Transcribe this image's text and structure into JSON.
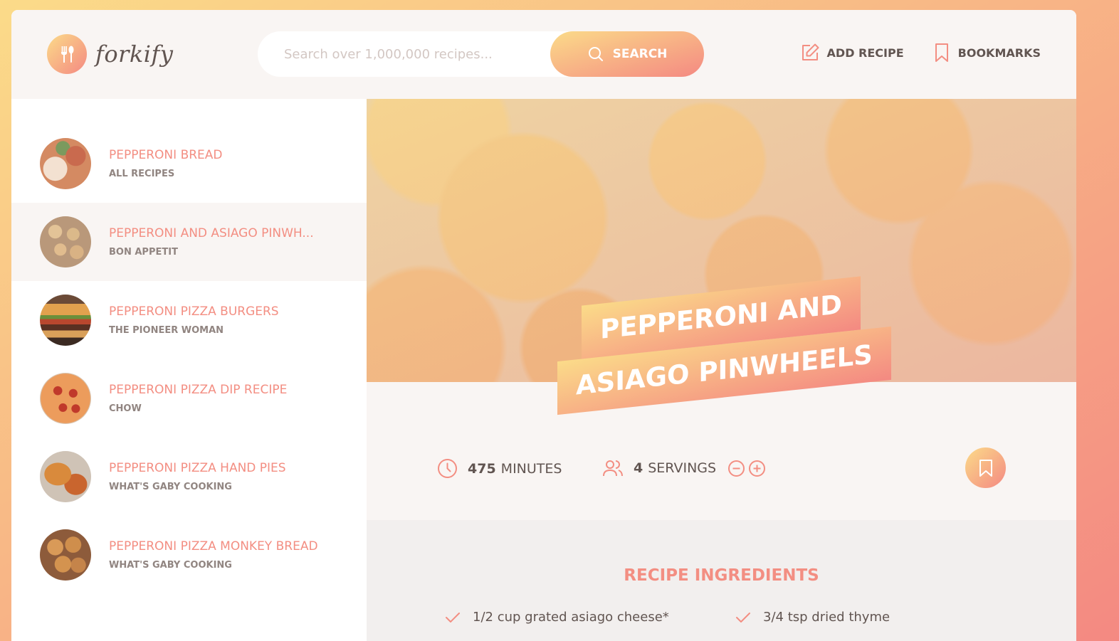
{
  "app": {
    "name": "forkify"
  },
  "search": {
    "placeholder": "Search over 1,000,000 recipes...",
    "button_label": "SEARCH"
  },
  "nav": {
    "add_recipe": "ADD RECIPE",
    "bookmarks": "BOOKMARKS"
  },
  "results": [
    {
      "title": "PEPPERONI BREAD",
      "publisher": "ALL RECIPES",
      "active": false
    },
    {
      "title": "PEPPERONI AND ASIAGO PINWH...",
      "publisher": "BON APPETIT",
      "active": true
    },
    {
      "title": "PEPPERONI PIZZA BURGERS",
      "publisher": "THE PIONEER WOMAN",
      "active": false
    },
    {
      "title": "PEPPERONI PIZZA DIP RECIPE",
      "publisher": "CHOW",
      "active": false
    },
    {
      "title": "PEPPERONI PIZZA HAND PIES",
      "publisher": "WHAT'S GABY COOKING",
      "active": false
    },
    {
      "title": "PEPPERONI PIZZA MONKEY BREAD",
      "publisher": "WHAT'S GABY COOKING",
      "active": false
    }
  ],
  "recipe": {
    "title_line1": "PEPPERONI AND",
    "title_line2": "ASIAGO PINWHEELS",
    "cooking_time": "475",
    "cooking_time_unit": "MINUTES",
    "servings": "4",
    "servings_unit": "SERVINGS",
    "ingredients_heading": "RECIPE INGREDIENTS",
    "ingredients": [
      "1/2 cup grated asiago cheese*",
      "3/4 tsp dried thyme"
    ]
  },
  "colors": {
    "accent_light": "#fbdb89",
    "accent_dark": "#f48982",
    "text": "#615551",
    "title": "#f38e82"
  },
  "icons": [
    "fork-spoon-icon",
    "search-icon",
    "edit-icon",
    "bookmark-icon",
    "clock-icon",
    "users-icon",
    "minus-circle-icon",
    "plus-circle-icon",
    "check-icon"
  ]
}
